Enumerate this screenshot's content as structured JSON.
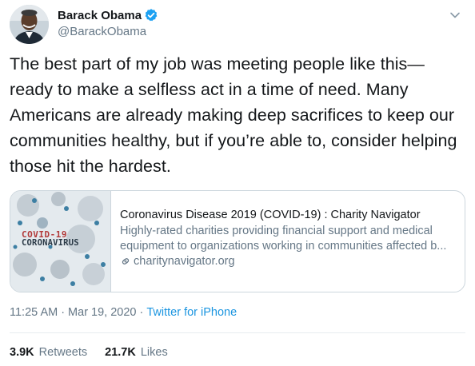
{
  "author": {
    "display_name": "Barack Obama",
    "handle": "@BarackObama",
    "verified": true,
    "verified_color": "#1da1f2",
    "avatar_icon": "profile-photo"
  },
  "tweet": {
    "text": "The best part of my job was meeting people like this—ready to make a selfless act in a time of need. Many Americans are already making deep sacrifices to keep our communities healthy, but if you’re able to, consider helping those hit the hardest."
  },
  "card": {
    "image_label_line1": "COVID-19",
    "image_label_line2": "CORONAVIRUS",
    "title": "Coronavirus Disease 2019 (COVID-19) : Charity Navigator",
    "description_line1": "Highly-rated charities providing financial support and medical",
    "description_line2": "equipment to organizations working in communities affected b...",
    "domain": "charitynavigator.org"
  },
  "meta": {
    "time": "11:25 AM",
    "separator": "·",
    "date": "Mar 19, 2020",
    "source": "Twitter for iPhone",
    "link_color": "#1b95e0"
  },
  "stats": {
    "retweets_count": "3.9K",
    "retweets_label": "Retweets",
    "likes_count": "21.7K",
    "likes_label": "Likes"
  }
}
